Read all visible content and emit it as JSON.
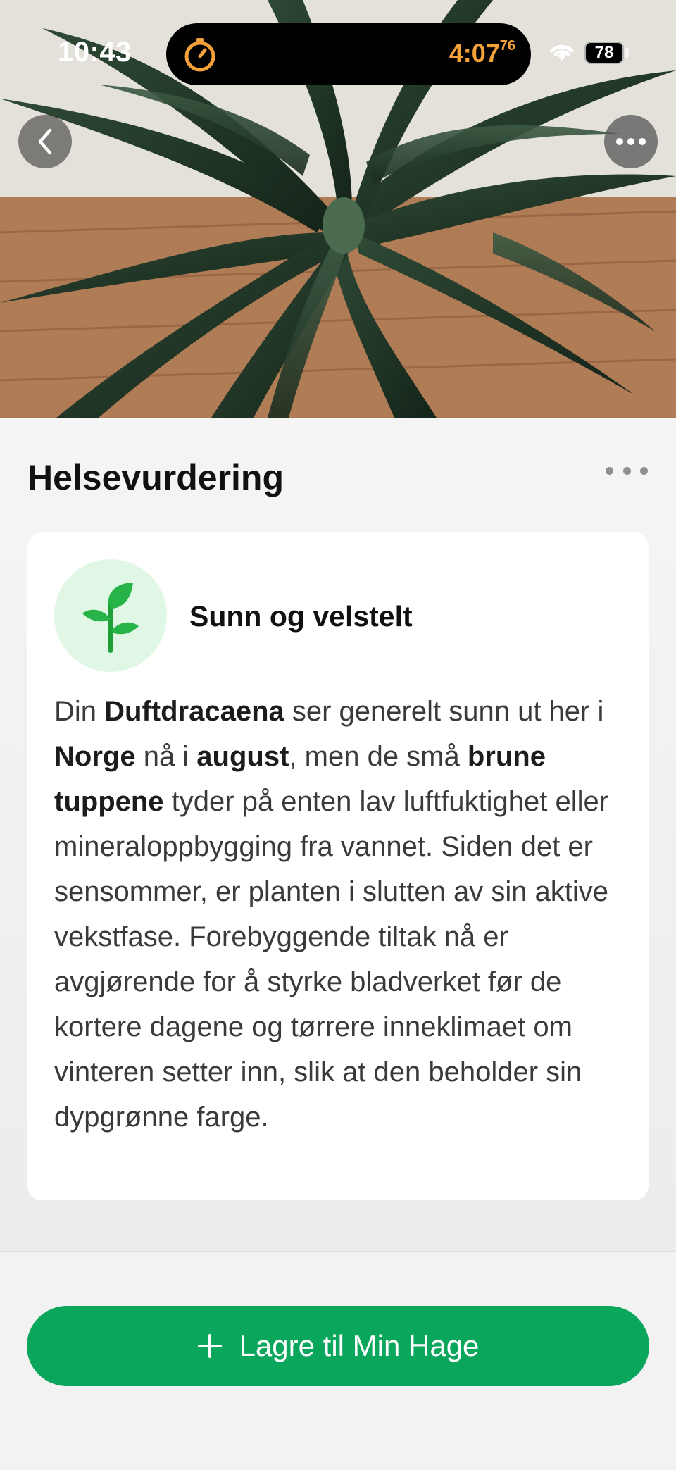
{
  "status_bar": {
    "time": "10:43",
    "timer": "4:07",
    "timer_fraction": "76",
    "battery": "78"
  },
  "hero": {
    "icons": [
      "back-chevron-icon",
      "ellipsis-icon"
    ]
  },
  "section": {
    "title": "Helsevurdering"
  },
  "card": {
    "status_label": "Sunn og velstelt",
    "icon": "sprout-icon",
    "body": [
      {
        "text": "Din ",
        "bold": false
      },
      {
        "text": "Duftdracaena",
        "bold": true
      },
      {
        "text": " ser generelt sunn ut her i ",
        "bold": false
      },
      {
        "text": "Norge",
        "bold": true
      },
      {
        "text": " nå i ",
        "bold": false
      },
      {
        "text": "august",
        "bold": true
      },
      {
        "text": ", men de små ",
        "bold": false
      },
      {
        "text": "brune tuppene",
        "bold": true
      },
      {
        "text": " tyder på enten lav luftfuktighet eller mineraloppbygging fra vannet. Siden det er sensommer, er planten i slutten av sin aktive vekstfase. Forebyggende tiltak nå er avgjørende for å styrke bladverket før de kortere dagene og tørrere inneklimaet om vinteren setter inn, slik at den beholder sin dypgrønne farge.",
        "bold": false
      }
    ]
  },
  "action": {
    "save_label": "Lagre til Min Hage"
  },
  "colors": {
    "accent_green": "#0aa65c",
    "timer_orange": "#f4a13a",
    "icon_bg": "#dff7e4"
  }
}
